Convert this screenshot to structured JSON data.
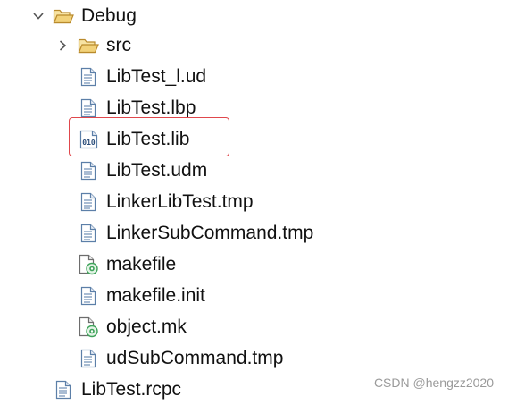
{
  "tree": {
    "items": [
      {
        "label": "Debug",
        "icon": "folder-open-icon",
        "expanded": true
      },
      {
        "label": "src",
        "icon": "folder-open-icon",
        "expanded": false
      },
      {
        "label": "LibTest_l.ud",
        "icon": "text-file-icon"
      },
      {
        "label": "LibTest.lbp",
        "icon": "text-file-icon"
      },
      {
        "label": "LibTest.lib",
        "icon": "binary-file-icon",
        "highlighted": true
      },
      {
        "label": "LibTest.udm",
        "icon": "text-file-icon"
      },
      {
        "label": "LinkerLibTest.tmp",
        "icon": "text-file-icon"
      },
      {
        "label": "LinkerSubCommand.tmp",
        "icon": "text-file-icon"
      },
      {
        "label": "makefile",
        "icon": "makefile-icon"
      },
      {
        "label": "makefile.init",
        "icon": "text-file-icon"
      },
      {
        "label": "object.mk",
        "icon": "makefile-icon"
      },
      {
        "label": "udSubCommand.tmp",
        "icon": "text-file-icon"
      },
      {
        "label": "LibTest.rcpc",
        "icon": "text-file-icon"
      }
    ]
  },
  "colors": {
    "highlight_border": "#e0474c",
    "folder_fill": "#f2d27a",
    "folder_stroke": "#b98a2c",
    "file_stroke": "#5c7fa8",
    "gear_green": "#3fa35a"
  },
  "watermark": "CSDN @hengzz2020"
}
